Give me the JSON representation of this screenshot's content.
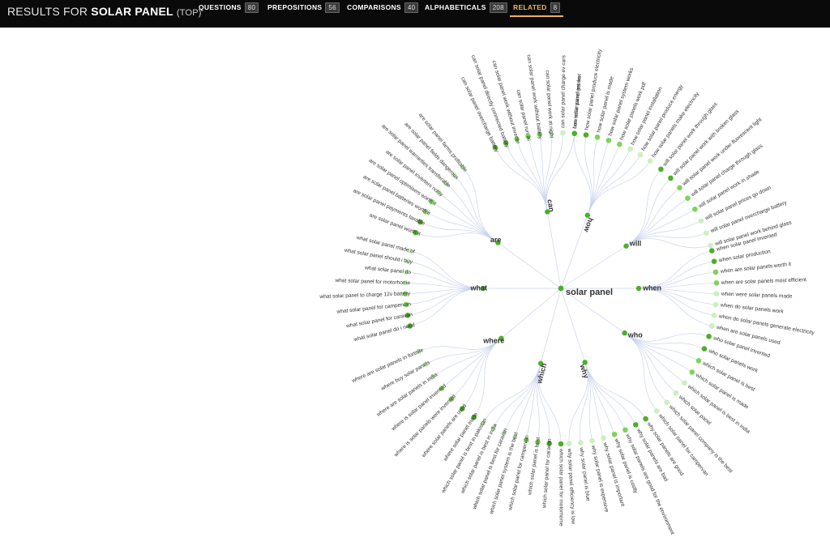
{
  "header": {
    "prefix": "RESULTS FOR",
    "query": "SOLAR PANEL",
    "scope": "(TOP)"
  },
  "tabs": [
    {
      "label": "QUESTIONS",
      "count": "80",
      "active": false
    },
    {
      "label": "PREPOSITIONS",
      "count": "56",
      "active": false
    },
    {
      "label": "COMPARISONS",
      "count": "40",
      "active": false
    },
    {
      "label": "ALPHABETICALS",
      "count": "208",
      "active": false
    },
    {
      "label": "RELATED",
      "count": "8",
      "active": true
    }
  ],
  "colors": {
    "header_bg": "#0a0a0a",
    "active_tab": "#e9b45a",
    "link": "#c9d3ee",
    "node_dark": "#4caf2a",
    "node_mid": "#7dd45a",
    "node_light": "#cdeec0",
    "label_text": "#333333"
  },
  "wheel": {
    "center": "solar panel",
    "branches": [
      {
        "word": "can",
        "items": [
          "can solar panel overcharge battery",
          "can solar panel directly connected battery",
          "can solar panel work without inverter",
          "can solar panel run ac",
          "can solar panel work without battery",
          "can solar panel work at night",
          "can solar panel charge ev cars",
          "can solar panel get wet"
        ],
        "strength": [
          3,
          3,
          2,
          2,
          2,
          1,
          1,
          0
        ]
      },
      {
        "word": "how",
        "items": [
          "how solar panel works",
          "how solar panel produce electricity",
          "how solar panel is made",
          "how solar panel system works",
          "how solar panels work pdf",
          "how solar panel installation",
          "how solar panel produce energy",
          "how solar panels make electricity"
        ],
        "strength": [
          3,
          3,
          2,
          2,
          2,
          1,
          1,
          0
        ]
      },
      {
        "word": "will",
        "items": [
          "will solar panel work through glass",
          "will solar panel work with broken glass",
          "will solar panel work under fluorescent light",
          "will solar panel charge through glass",
          "will solar panel work in shade",
          "will solar panel prices go down",
          "will solar panel overcharge battery",
          "will solar panel work behind glass"
        ],
        "strength": [
          3,
          3,
          2,
          2,
          2,
          1,
          1,
          0
        ]
      },
      {
        "word": "when",
        "items": [
          "when solar panel invented",
          "when solar production",
          "when are solar panels worth it",
          "when are solar panels most efficient",
          "when were solar panels made",
          "when do solar panels work",
          "when do solar panels generate electricity",
          "when are solar panels used"
        ],
        "strength": [
          3,
          3,
          2,
          2,
          1,
          1,
          0,
          0
        ]
      },
      {
        "word": "who",
        "items": [
          "who solar panel invented",
          "who solar panels work",
          "which solar panel is best",
          "which solar panel is made",
          "which solar panel is best in india",
          "which solar panel",
          "which solar panel company is the best",
          "which solar panel for campervan"
        ],
        "strength": [
          3,
          3,
          2,
          2,
          1,
          1,
          0,
          0
        ]
      },
      {
        "word": "why",
        "items": [
          "why solar panels are good",
          "why solar panels are bad",
          "why solar panels are good for the environment",
          "why solar panel is costly",
          "why solar panel is important",
          "why solar panel is expensive",
          "why solar panel is blue",
          "why solar panel efficiency is low"
        ],
        "strength": [
          3,
          3,
          2,
          2,
          1,
          1,
          0,
          0
        ]
      },
      {
        "word": "which",
        "items": [
          "which solar panel for motorhome",
          "which solar panel for caravan",
          "which solar panel is best",
          "which solar panel for campervan",
          "which solar panel system is the best",
          "which solar panel is best for caravan",
          "which solar panel is best in india",
          "which solar panel is best in pakistan"
        ],
        "strength": [
          3,
          3,
          2,
          2,
          1,
          1,
          0,
          0
        ]
      },
      {
        "word": "where",
        "items": [
          "where solar panel made",
          "where solar panels are used",
          "where is solar panels were invented",
          "where is solar panel invented",
          "where are solar panels in india",
          "where buy solar panels",
          "where are solar panels in fortnite"
        ],
        "strength": [
          3,
          3,
          2,
          2,
          1,
          1,
          0
        ]
      },
      {
        "word": "what",
        "items": [
          "what solar panel do i need",
          "what solar panel for caravan",
          "what solar panel for campervan",
          "what solar panel to charge 12v battery",
          "what solar panel for motorhome",
          "what solar panel do",
          "what solar panel should i buy",
          "what solar panel made of"
        ],
        "strength": [
          3,
          3,
          2,
          2,
          1,
          1,
          0,
          0
        ]
      },
      {
        "word": "are",
        "items": [
          "are solar panel worth it",
          "are solar panel payments taxable",
          "are solar panel batteries worth it",
          "are solar panel optimisers worth it",
          "are solar panel inverters noisy",
          "are solar panel warranties transferable",
          "are solar panel fields dangerous",
          "are solar panel farms profitable"
        ],
        "strength": [
          3,
          3,
          2,
          2,
          1,
          1,
          0,
          0
        ]
      }
    ]
  }
}
